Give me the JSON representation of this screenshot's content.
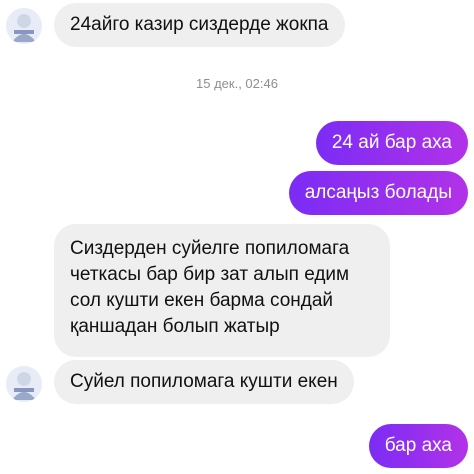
{
  "colors": {
    "incoming_bubble": "#efefef",
    "outgoing_gradient_start": "#7b2cf5",
    "outgoing_gradient_end": "#b232e8",
    "timestamp_text": "#8e8e8e"
  },
  "avatar_icon": "profile-photo",
  "timestamp": "15 дек., 02:46",
  "messages": [
    {
      "from": "them",
      "text": "24айго казир сиздерде жокпа"
    },
    {
      "from": "me",
      "text": "24 ай бар аха"
    },
    {
      "from": "me",
      "text": "алсаңыз болады"
    },
    {
      "from": "them",
      "lines": [
        "Сиздерден суйелге попиломага",
        "четкасы бар бир зат алып едим",
        "сол кушти екен барма сондай",
        "қаншадан болып жатыр"
      ]
    },
    {
      "from": "them",
      "text": "Суйел попиломага кушти екен"
    },
    {
      "from": "me",
      "text": "бар аха"
    }
  ]
}
